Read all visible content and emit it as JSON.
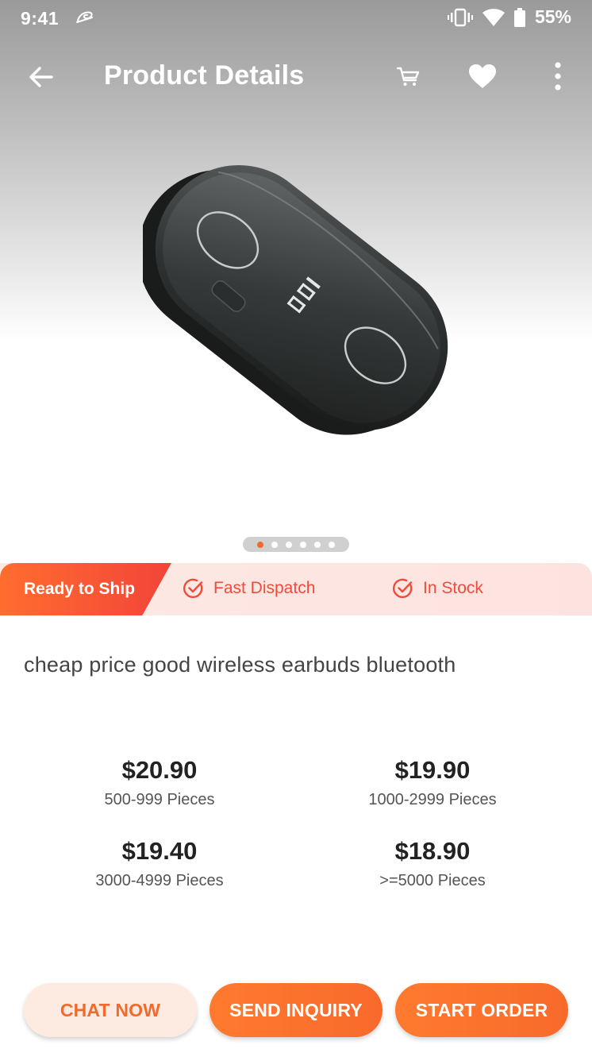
{
  "status_bar": {
    "time": "9:41",
    "battery": "55%"
  },
  "app_bar": {
    "title": "Product Details"
  },
  "gallery": {
    "image_count": 6,
    "active_index": 0
  },
  "tags": {
    "ready": "Ready to Ship",
    "feature_1": "Fast Dispatch",
    "feature_2": "In Stock"
  },
  "product": {
    "title": "cheap price good wireless earbuds bluetooth",
    "prices": [
      {
        "price": "$20.90",
        "qty": "500-999 Pieces"
      },
      {
        "price": "$19.90",
        "qty": "1000-2999 Pieces"
      },
      {
        "price": "$19.40",
        "qty": "3000-4999 Pieces"
      },
      {
        "price": "$18.90",
        "qty": ">=5000 Pieces"
      }
    ]
  },
  "actions": {
    "chat": "CHAT NOW",
    "inquiry": "SEND INQUIRY",
    "order": "START ORDER"
  },
  "colors": {
    "accent": "#f26a2b",
    "tag_red": "#f04b3a",
    "tag_bg": "#fde6e2"
  }
}
